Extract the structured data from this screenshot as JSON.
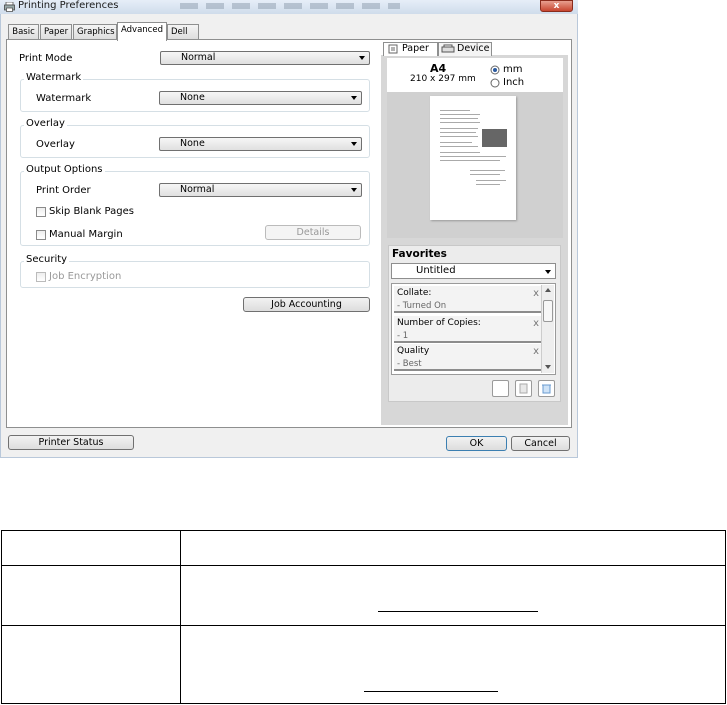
{
  "window": {
    "title": "Printing Preferences",
    "close_glyph": "x"
  },
  "tabs": [
    {
      "label": "Basic"
    },
    {
      "label": "Paper"
    },
    {
      "label": "Graphics"
    },
    {
      "label": "Advanced",
      "active": true
    },
    {
      "label": "Dell"
    }
  ],
  "print_mode": {
    "label": "Print Mode",
    "value": "Normal"
  },
  "watermark": {
    "group": "Watermark",
    "label": "Watermark",
    "value": "None"
  },
  "overlay": {
    "group": "Overlay",
    "label": "Overlay",
    "value": "None"
  },
  "output_options": {
    "group": "Output Options",
    "print_order_label": "Print Order",
    "print_order_value": "Normal",
    "skip_blank": "Skip Blank Pages",
    "manual_margin": "Manual Margin",
    "details": "Details"
  },
  "security": {
    "group": "Security",
    "job_encryption": "Job Encryption"
  },
  "job_accounting": "Job Accounting",
  "preview": {
    "tab_paper": "Paper",
    "tab_device": "Device",
    "size_name": "A4",
    "size_dims": "210 x 297 mm",
    "unit_mm": "mm",
    "unit_inch": "Inch"
  },
  "favorites": {
    "title": "Favorites",
    "selected": "Untitled",
    "items": [
      {
        "name": "Collate:",
        "value": "- Turned On"
      },
      {
        "name": "Number of Copies:",
        "value": "- 1"
      },
      {
        "name": "Quality",
        "value": "- Best"
      }
    ]
  },
  "footer": {
    "printer_status": "Printer Status",
    "ok": "OK",
    "cancel": "Cancel"
  }
}
